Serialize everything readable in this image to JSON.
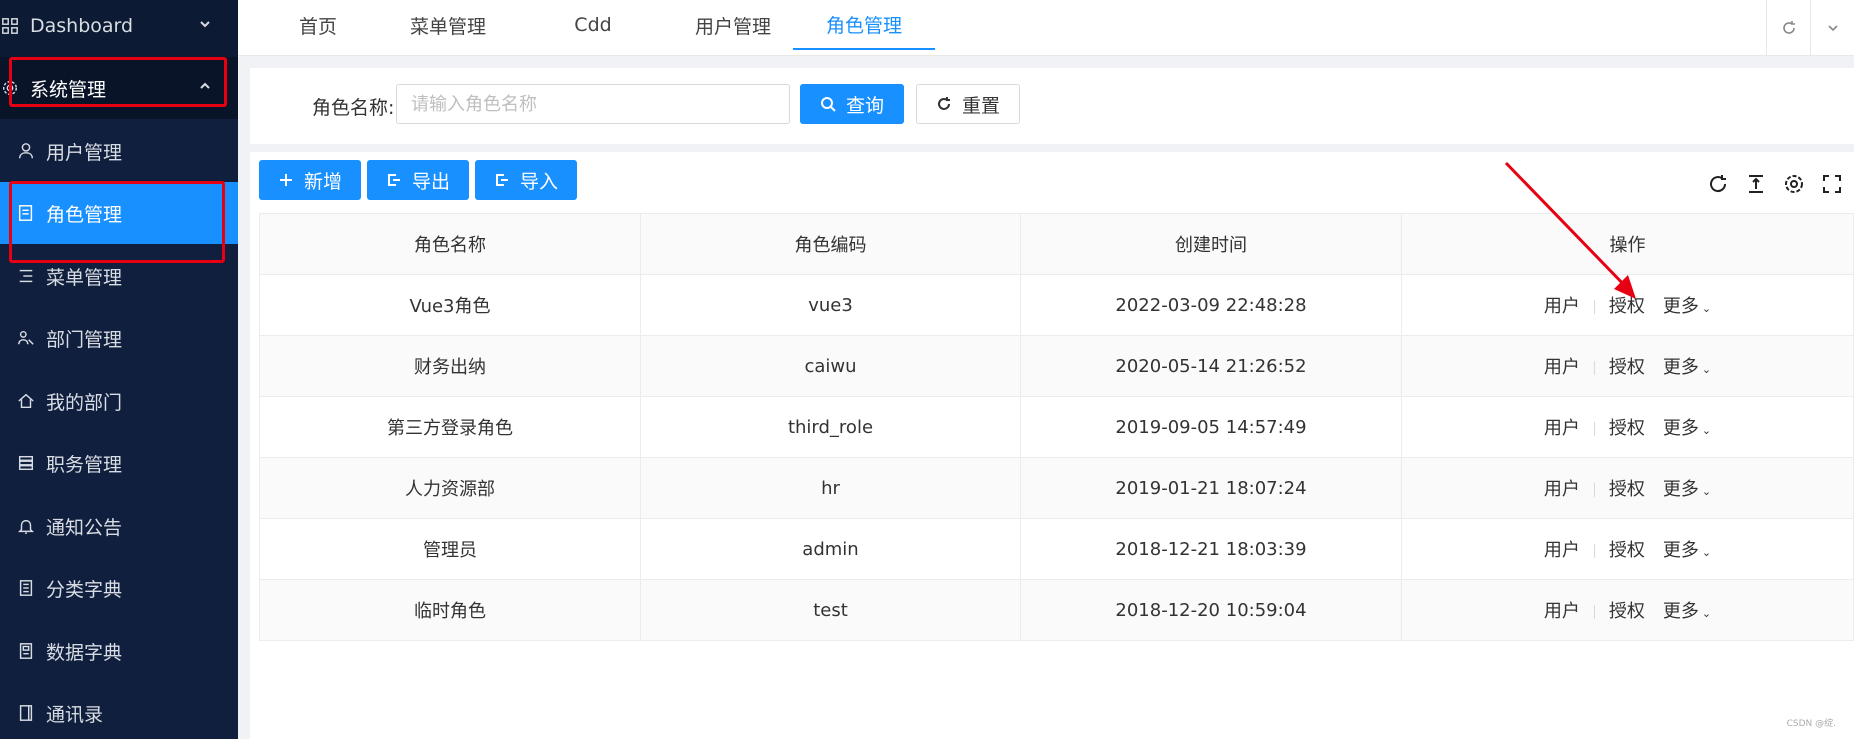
{
  "sidebar": {
    "dashboard": "Dashboard",
    "system": "系统管理",
    "items": [
      {
        "label": "用户管理",
        "icon": "user-icon"
      },
      {
        "label": "角色管理",
        "icon": "role-doc-icon",
        "active": true
      },
      {
        "label": "菜单管理",
        "icon": "menu-list-icon"
      },
      {
        "label": "部门管理",
        "icon": "dept-icon"
      },
      {
        "label": "我的部门",
        "icon": "home-icon"
      },
      {
        "label": "职务管理",
        "icon": "server-icon"
      },
      {
        "label": "通知公告",
        "icon": "bell-icon"
      },
      {
        "label": "分类字典",
        "icon": "book-icon"
      },
      {
        "label": "数据字典",
        "icon": "dict-icon"
      },
      {
        "label": "通讯录",
        "icon": "contacts-icon"
      }
    ]
  },
  "tabs": [
    "首页",
    "菜单管理",
    "Cdd",
    "用户管理",
    "角色管理"
  ],
  "search": {
    "label": "角色名称:",
    "placeholder": "请输入角色名称",
    "query": "查询",
    "reset": "重置"
  },
  "toolbar": {
    "add": "新增",
    "export": "导出",
    "import": "导入"
  },
  "table": {
    "headers": [
      "角色名称",
      "角色编码",
      "创建时间",
      "操作"
    ],
    "rows": [
      {
        "name": "Vue3角色",
        "code": "vue3",
        "created": "2022-03-09 22:48:28"
      },
      {
        "name": "财务出纳",
        "code": "caiwu",
        "created": "2020-05-14 21:26:52"
      },
      {
        "name": "第三方登录角色",
        "code": "third_role",
        "created": "2019-09-05 14:57:49"
      },
      {
        "name": "人力资源部",
        "code": "hr",
        "created": "2019-01-21 18:07:24"
      },
      {
        "name": "管理员",
        "code": "admin",
        "created": "2018-12-21 18:03:39"
      },
      {
        "name": "临时角色",
        "code": "test",
        "created": "2018-12-20 10:59:04"
      }
    ],
    "actions": {
      "user": "用户",
      "auth": "授权",
      "more": "更多"
    }
  },
  "watermark": "CSDN @绽.",
  "colors": {
    "primary": "#1890ff",
    "sidebar": "#0f1f3d",
    "annotation": "#e60012"
  }
}
